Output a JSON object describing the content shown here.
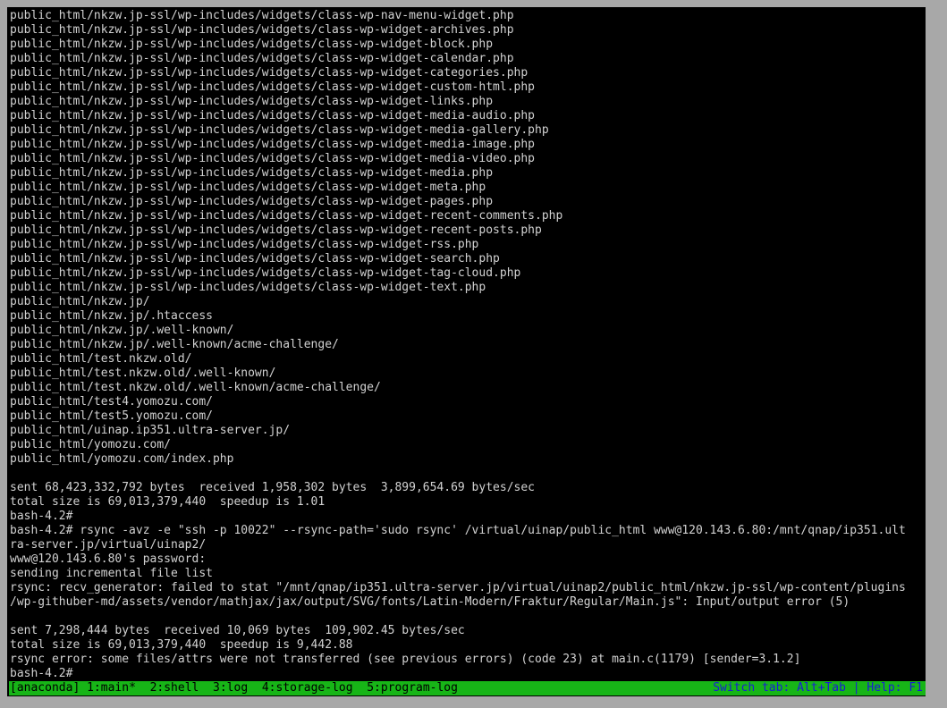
{
  "terminal": {
    "lines": [
      "public_html/nkzw.jp-ssl/wp-includes/widgets/class-wp-nav-menu-widget.php",
      "public_html/nkzw.jp-ssl/wp-includes/widgets/class-wp-widget-archives.php",
      "public_html/nkzw.jp-ssl/wp-includes/widgets/class-wp-widget-block.php",
      "public_html/nkzw.jp-ssl/wp-includes/widgets/class-wp-widget-calendar.php",
      "public_html/nkzw.jp-ssl/wp-includes/widgets/class-wp-widget-categories.php",
      "public_html/nkzw.jp-ssl/wp-includes/widgets/class-wp-widget-custom-html.php",
      "public_html/nkzw.jp-ssl/wp-includes/widgets/class-wp-widget-links.php",
      "public_html/nkzw.jp-ssl/wp-includes/widgets/class-wp-widget-media-audio.php",
      "public_html/nkzw.jp-ssl/wp-includes/widgets/class-wp-widget-media-gallery.php",
      "public_html/nkzw.jp-ssl/wp-includes/widgets/class-wp-widget-media-image.php",
      "public_html/nkzw.jp-ssl/wp-includes/widgets/class-wp-widget-media-video.php",
      "public_html/nkzw.jp-ssl/wp-includes/widgets/class-wp-widget-media.php",
      "public_html/nkzw.jp-ssl/wp-includes/widgets/class-wp-widget-meta.php",
      "public_html/nkzw.jp-ssl/wp-includes/widgets/class-wp-widget-pages.php",
      "public_html/nkzw.jp-ssl/wp-includes/widgets/class-wp-widget-recent-comments.php",
      "public_html/nkzw.jp-ssl/wp-includes/widgets/class-wp-widget-recent-posts.php",
      "public_html/nkzw.jp-ssl/wp-includes/widgets/class-wp-widget-rss.php",
      "public_html/nkzw.jp-ssl/wp-includes/widgets/class-wp-widget-search.php",
      "public_html/nkzw.jp-ssl/wp-includes/widgets/class-wp-widget-tag-cloud.php",
      "public_html/nkzw.jp-ssl/wp-includes/widgets/class-wp-widget-text.php",
      "public_html/nkzw.jp/",
      "public_html/nkzw.jp/.htaccess",
      "public_html/nkzw.jp/.well-known/",
      "public_html/nkzw.jp/.well-known/acme-challenge/",
      "public_html/test.nkzw.old/",
      "public_html/test.nkzw.old/.well-known/",
      "public_html/test.nkzw.old/.well-known/acme-challenge/",
      "public_html/test4.yomozu.com/",
      "public_html/test5.yomozu.com/",
      "public_html/uinap.ip351.ultra-server.jp/",
      "public_html/yomozu.com/",
      "public_html/yomozu.com/index.php",
      "",
      "sent 68,423,332,792 bytes  received 1,958,302 bytes  3,899,654.69 bytes/sec",
      "total size is 69,013,379,440  speedup is 1.01",
      "bash-4.2#",
      "bash-4.2# rsync -avz -e \"ssh -p 10022\" --rsync-path='sudo rsync' /virtual/uinap/public_html www@120.143.6.80:/mnt/qnap/ip351.ult",
      "ra-server.jp/virtual/uinap2/",
      "www@120.143.6.80's password:",
      "sending incremental file list",
      "rsync: recv_generator: failed to stat \"/mnt/qnap/ip351.ultra-server.jp/virtual/uinap2/public_html/nkzw.jp-ssl/wp-content/plugins",
      "/wp-githuber-md/assets/vendor/mathjax/jax/output/SVG/fonts/Latin-Modern/Fraktur/Regular/Main.js\": Input/output error (5)",
      "",
      "sent 7,298,444 bytes  received 10,069 bytes  109,902.45 bytes/sec",
      "total size is 69,013,379,440  speedup is 9,442.88",
      "rsync error: some files/attrs were not transferred (see previous errors) (code 23) at main.c(1179) [sender=3.1.2]",
      "bash-4.2#"
    ]
  },
  "statusbar": {
    "session": "[anaconda]",
    "windows": [
      {
        "label": "1:main*"
      },
      {
        "label": "2:shell"
      },
      {
        "label": "3:log"
      },
      {
        "label": "4:storage-log"
      },
      {
        "label": "5:program-log"
      }
    ],
    "right_text": "Switch tab: Alt+Tab | Help: F1"
  },
  "colors": {
    "background": "#000000",
    "text": "#d2d2d2",
    "statusbar_bg": "#17b517",
    "statusbar_right_text": "#1a1ad8"
  }
}
